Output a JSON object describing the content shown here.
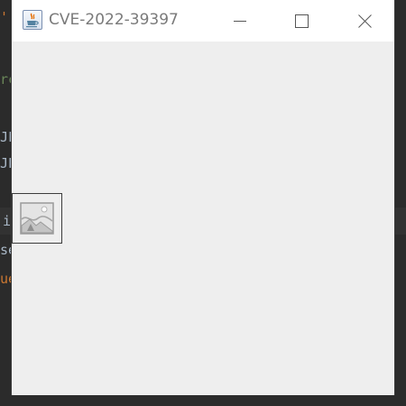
{
  "window": {
    "title": "CVE-2022-39397"
  },
  "titlebar_buttons": {
    "minimize": "minimize",
    "maximize": "maximize",
    "close": "close"
  },
  "icons": {
    "app": "java-app-icon",
    "broken_image": "broken-image-icon"
  },
  "background_fragments": [
    {
      "text": "'",
      "color": "#cc7832"
    },
    {
      "text": "rc",
      "color": "#6a8759"
    },
    {
      "text": "JF",
      "color": "#a9b7c6"
    },
    {
      "text": "JL",
      "color": "#a9b7c6"
    },
    {
      "text": "i",
      "color": "#a9b7c6"
    },
    {
      "text": "se",
      "color": "#a9b7c6"
    },
    {
      "text": "ue",
      "color": "#cc7832"
    }
  ],
  "colors": {
    "window_bg": "#eeeeee",
    "titlebar_bg": "#ffffff",
    "title_text": "#7a7a7a",
    "ide_bg": "#2b2b2b"
  }
}
